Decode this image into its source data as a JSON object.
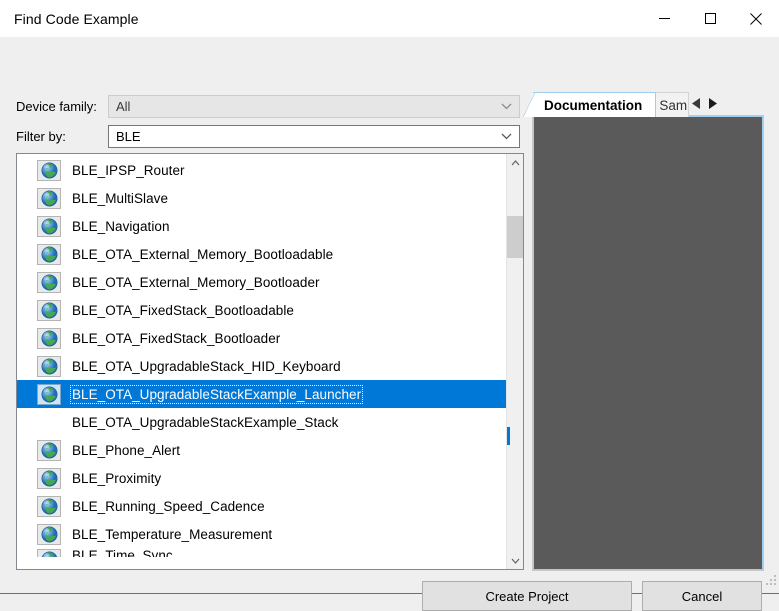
{
  "window": {
    "title": "Find Code Example",
    "caption_buttons": [
      {
        "name": "minimize",
        "glyph": "minimize-icon"
      },
      {
        "name": "maximize",
        "glyph": "maximize-icon"
      },
      {
        "name": "close",
        "glyph": "close-icon"
      }
    ]
  },
  "form": {
    "device_family": {
      "label": "Device family:",
      "value": "All",
      "enabled": false
    },
    "filter_by": {
      "label": "Filter by:",
      "value": "BLE",
      "enabled": true
    }
  },
  "list": {
    "items": [
      {
        "label": "BLE_IPSP_Router",
        "icon": "globe-icon",
        "selected": false
      },
      {
        "label": "BLE_MultiSlave",
        "icon": "globe-icon",
        "selected": false
      },
      {
        "label": "BLE_Navigation",
        "icon": "globe-icon",
        "selected": false
      },
      {
        "label": "BLE_OTA_External_Memory_Bootloadable",
        "icon": "globe-icon",
        "selected": false
      },
      {
        "label": "BLE_OTA_External_Memory_Bootloader",
        "icon": "globe-icon",
        "selected": false
      },
      {
        "label": "BLE_OTA_FixedStack_Bootloadable",
        "icon": "globe-icon",
        "selected": false
      },
      {
        "label": "BLE_OTA_FixedStack_Bootloader",
        "icon": "globe-icon",
        "selected": false
      },
      {
        "label": "BLE_OTA_UpgradableStack_HID_Keyboard",
        "icon": "globe-icon",
        "selected": false
      },
      {
        "label": "BLE_OTA_UpgradableStackExample_Launcher",
        "icon": "globe-icon",
        "selected": true
      },
      {
        "label": "BLE_OTA_UpgradableStackExample_Stack",
        "icon": null,
        "selected": false
      },
      {
        "label": "BLE_Phone_Alert",
        "icon": "globe-icon",
        "selected": false
      },
      {
        "label": "BLE_Proximity",
        "icon": "globe-icon",
        "selected": false
      },
      {
        "label": "BLE_Running_Speed_Cadence",
        "icon": "globe-icon",
        "selected": false
      },
      {
        "label": "BLE_Temperature_Measurement",
        "icon": "globe-icon",
        "selected": false
      },
      {
        "label": "BLE_Time_Sync",
        "icon": "globe-icon",
        "selected": false
      }
    ],
    "scrollbar": {
      "up_arrow": "chevron-up-icon",
      "down_arrow": "chevron-down-icon"
    }
  },
  "doc_panel": {
    "tabs": [
      {
        "label": "Documentation",
        "active": true
      },
      {
        "label": "Sam",
        "active": false
      }
    ],
    "nav_prev": "triangle-left-icon",
    "nav_next": "triangle-right-icon"
  },
  "footer": {
    "create_label": "Create Project",
    "cancel_label": "Cancel"
  },
  "colors": {
    "selection": "#0078d7",
    "dialog_bg": "#efefef",
    "doc_bg": "#5a5a5a",
    "tab_accent": "#9fcdf0"
  }
}
